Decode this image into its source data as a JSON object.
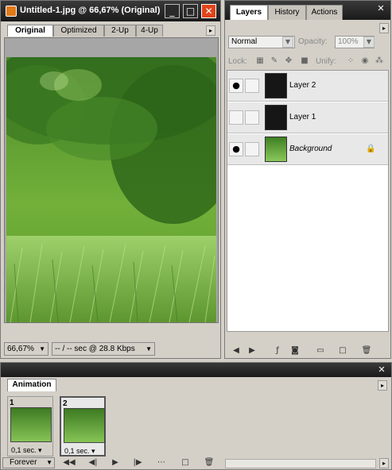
{
  "document": {
    "title": "Untitled-1.jpg @ 66,67% (Original)",
    "window_buttons": [
      "_",
      "□",
      "✕"
    ],
    "view_tabs": [
      "Original",
      "Optimized",
      "2-Up",
      "4-Up"
    ],
    "active_view_tab": "Original",
    "status": {
      "zoom": "66,67%",
      "download_info": "-- / -- sec @ 28.8 Kbps"
    }
  },
  "layers_panel": {
    "tabs": [
      "Layers",
      "History",
      "Actions"
    ],
    "active_tab": "Layers",
    "blend_mode": "Normal",
    "opacity_label": "Opacity:",
    "opacity_value": "100%",
    "lock_label": "Lock:",
    "unify_label": "Unify:",
    "layers": [
      {
        "name": "Layer 2",
        "visible": true,
        "thumb": "dark"
      },
      {
        "name": "Layer 1",
        "visible": false,
        "thumb": "dark"
      },
      {
        "name": "Background",
        "visible": true,
        "thumb": "green",
        "locked": true
      }
    ]
  },
  "animation_panel": {
    "tab": "Animation",
    "frames": [
      {
        "number": "1",
        "delay": "0,1 sec."
      },
      {
        "number": "2",
        "delay": "0,1 sec."
      }
    ],
    "loop": "Forever"
  },
  "colors": {
    "titlebar": "#1f1f1f",
    "panel_bg": "#d4d0c8",
    "canvas_gray": "#a6a6a6",
    "close_red": "#e0441a"
  }
}
